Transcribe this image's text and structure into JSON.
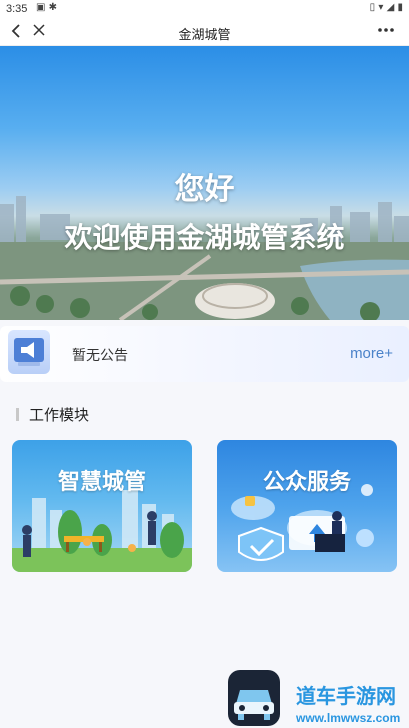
{
  "status_bar": {
    "time": "3:35",
    "left_icons": [
      "image-icon",
      "bug-icon"
    ],
    "right_icons": [
      "vibrate-icon",
      "wifi-icon",
      "signal-icon",
      "battery-icon"
    ]
  },
  "nav": {
    "title": "金湖城管",
    "back_icon": "chevron-left-icon",
    "close_icon": "close-icon",
    "more_icon": "more-icon"
  },
  "banner": {
    "greeting": "您好",
    "welcome": "欢迎使用金湖城管系统"
  },
  "notice": {
    "icon": "megaphone-icon",
    "text": "暂无公告",
    "more": "more+"
  },
  "section": {
    "title": "工作模块"
  },
  "modules": [
    {
      "label": "智慧城管"
    },
    {
      "label": "公众服务"
    }
  ],
  "watermark": {
    "title": "道车手游网",
    "url": "www.lmwwsz.com"
  },
  "colors": {
    "accent": "#4a82c9",
    "watermark": "#2a96e0"
  }
}
